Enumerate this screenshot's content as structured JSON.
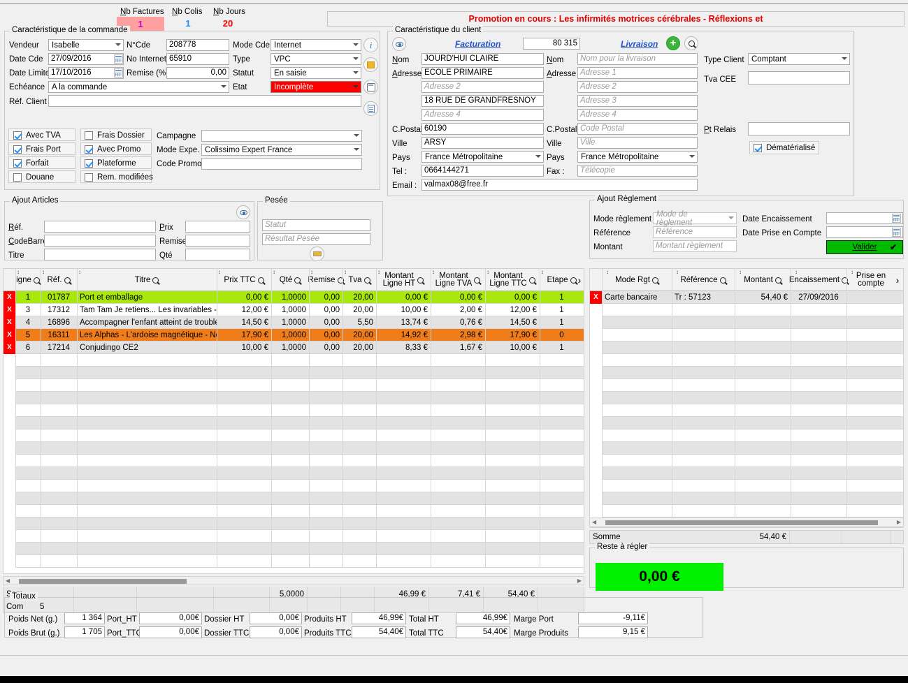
{
  "header": {
    "nb_factures_label": "Nb Factures",
    "nb_factures_value": "1",
    "nb_colis_label": "Nb Colis",
    "nb_colis_value": "1",
    "nb_jours_label": "Nb Jours",
    "nb_jours_value": "20",
    "promo_text": "Promotion en cours : Les infirmités motrices cérébrales - Réflexions et"
  },
  "order": {
    "caption": "Caractéristique de la commande",
    "vendeur_label": "Vendeur",
    "vendeur_value": "Isabelle",
    "date_cde_label": "Date Cde",
    "date_cde_value": "27/09/2016",
    "date_limite_label": "Date Limite",
    "date_limite_value": "17/10/2016",
    "echeance_label": "Echéance",
    "echeance_value": "A la commande",
    "ref_client_label": "Réf. Client",
    "ref_client_value": "",
    "ncde_label": "N°Cde",
    "ncde_value": "208778",
    "no_internet_label": "No Internet",
    "no_internet_value": "65910",
    "remise_label": "Remise (%)",
    "remise_value": "0,00",
    "mode_cde_label": "Mode Cde",
    "mode_cde_value": "Internet",
    "type_label": "Type",
    "type_value": "VPC",
    "statut_label": "Statut",
    "statut_value": "En saisie",
    "etat_label": "Etat",
    "etat_value": "Incomplète"
  },
  "checkboxes": [
    {
      "label": "Avec TVA",
      "checked": true
    },
    {
      "label": "Frais Port",
      "checked": true
    },
    {
      "label": "Forfait",
      "checked": true
    },
    {
      "label": "Douane",
      "checked": false
    },
    {
      "label": "Frais Dossier",
      "checked": false
    },
    {
      "label": "Avec Promo",
      "checked": true
    },
    {
      "label": "Plateforme",
      "checked": true
    },
    {
      "label": "Rem. modifiées",
      "checked": false
    }
  ],
  "campaign": {
    "campagne_label": "Campagne",
    "campagne_value": "",
    "mode_expe_label": "Mode Expe.",
    "mode_expe_value": "Colissimo Expert France",
    "code_promo_label": "Code Promo",
    "code_promo_value": ""
  },
  "client": {
    "caption": "Caractéristique du client",
    "facturation_link": "Facturation",
    "client_id": "80 315",
    "livraison_link": "Livraison",
    "nom_label": "Nom",
    "nom_value": "JOURD'HUI CLAIRE",
    "adresse_label": "Adresse",
    "adresse1_value": "ECOLE PRIMAIRE",
    "adresse2_ph": "Adresse 2",
    "adresse3_value": "18 RUE DE GRANDFRESNOY",
    "adresse4_ph": "Adresse 4",
    "cpostal_label": "C.Postal",
    "cpostal_value": "60190",
    "ville_label": "Ville",
    "ville_value": "ARSY",
    "pays_label": "Pays",
    "pays_value": "France Métropolitaine",
    "tel_label": "Tel :",
    "tel_value": "0664144271",
    "email_label": "Email :",
    "email_value": "valmax08@free.fr",
    "liv_nom_ph": "Nom pour la livraison",
    "liv_adresse1_ph": "Adresse 1",
    "liv_adresse2_ph": "Adresse 2",
    "liv_adresse3_ph": "Adresse 3",
    "liv_adresse4_ph": "Adresse 4",
    "liv_cp_ph": "Code Postal",
    "liv_ville_ph": "Ville",
    "liv_pays_value": "France Métropolitaine",
    "fax_label": "Fax :",
    "fax_ph": "Télécopie",
    "type_client_label": "Type Client",
    "type_client_value": "Comptant",
    "tva_cee_label": "Tva CEE",
    "tva_cee_value": "",
    "pt_relais_label": "Pt Relais",
    "pt_relais_value": "",
    "dematerialise_label": "Dématérialisé",
    "dematerialise_checked": true
  },
  "ajout_articles": {
    "caption": "Ajout Articles",
    "ref_label": "Réf.",
    "ref_value": "",
    "codebarre_label": "CodeBarre",
    "codebarre_value": "",
    "titre_label": "Titre",
    "titre_value": "",
    "prix_label": "Prix",
    "prix_value": "",
    "remise_label": "Remise",
    "remise_value": "",
    "qte_label": "Qté",
    "qte_value": ""
  },
  "pesee": {
    "caption": "Pesée",
    "statut_ph": "Statut",
    "resultat_ph": "Résultat Pesée"
  },
  "ajout_reglement": {
    "caption": "Ajout Règlement",
    "mode_label": "Mode règlement",
    "mode_ph": "Mode de règlement",
    "reference_label": "Référence",
    "reference_ph": "Référence",
    "montant_label": "Montant",
    "montant_ph": "Montant règlement",
    "date_encaissement_label": "Date Encaissement",
    "date_encaissement_value": "",
    "date_prise_label": "Date Prise en Compte",
    "date_prise_value": "",
    "valider_label": "Valider"
  },
  "articles_table": {
    "columns": [
      "igne",
      "Réf.",
      "Titre",
      "Prix TTC",
      "Qté",
      "Remise",
      "Tva",
      "Montant Ligne HT",
      "Montant Ligne TVA",
      "Montant Ligne TTC",
      "Etape"
    ],
    "rows": [
      {
        "x": "X",
        "ligne": "1",
        "ref": "01787",
        "titre": "Port et emballage",
        "prix": "0,00 €",
        "qte": "1,0000",
        "remise": "0,00",
        "tva": "20,00",
        "ht": "0,00 €",
        "tva_m": "0,00 €",
        "ttc": "0,00 €",
        "etape": "1",
        "hl": "green"
      },
      {
        "x": "X",
        "ligne": "3",
        "ref": "17312",
        "titre": "Tam Tam Je retiens... Les invariables - C",
        "prix": "12,00 €",
        "qte": "1,0000",
        "remise": "0,00",
        "tva": "20,00",
        "ht": "10,00 €",
        "tva_m": "2,00 €",
        "ttc": "12,00 €",
        "etape": "1",
        "hl": "white"
      },
      {
        "x": "X",
        "ligne": "4",
        "ref": "16896",
        "titre": "Accompagner l'enfant atteint de troubles",
        "prix": "14,50 €",
        "qte": "1,0000",
        "remise": "0,00",
        "tva": "5,50",
        "ht": "13,74 €",
        "tva_m": "0,76 €",
        "ttc": "14,50 €",
        "etape": "1",
        "hl": "alt"
      },
      {
        "x": "X",
        "ligne": "5",
        "ref": "16311",
        "titre": "Les Alphas - L'ardoise magnétique - Nouv",
        "prix": "17,90 €",
        "qte": "1,0000",
        "remise": "0,00",
        "tva": "20,00",
        "ht": "14,92 €",
        "tva_m": "2,98 €",
        "ttc": "17,90 €",
        "etape": "0",
        "hl": "orange"
      },
      {
        "x": "X",
        "ligne": "6",
        "ref": "17214",
        "titre": "Conjudingo CE2",
        "prix": "10,00 €",
        "qte": "1,0000",
        "remise": "0,00",
        "tva": "20,00",
        "ht": "8,33 €",
        "tva_m": "1,67 €",
        "ttc": "10,00 €",
        "etape": "1",
        "hl": "alt"
      }
    ],
    "footer": {
      "somme_label": "Som",
      "compte_label": "Com",
      "compte_value": "5",
      "qte_total": "5,0000",
      "ht_total": "46,99 €",
      "tva_total": "7,41 €",
      "ttc_total": "54,40 €"
    }
  },
  "payments_table": {
    "columns": [
      "Mode Rgt",
      "Référence",
      "Montant",
      "Encaissement",
      "Prise en compte"
    ],
    "rows": [
      {
        "x": "X",
        "mode": "Carte bancaire",
        "reference": "Tr : 57123",
        "montant": "54,40 €",
        "encaissement": "27/09/2016",
        "prise": ""
      }
    ],
    "somme_label": "Somme",
    "somme_value": "54,40 €"
  },
  "reste": {
    "caption": "Reste à régler",
    "value": "0,00 €"
  },
  "totaux": {
    "caption": "Totaux",
    "poids_net_label": "Poids Net (g.)",
    "poids_net_value": "1 364",
    "poids_brut_label": "Poids Brut (g.)",
    "poids_brut_value": "1 705",
    "port_ht_label": "Port_HT",
    "port_ht_value": "0,00€",
    "port_ttc_label": "Port_TTC",
    "port_ttc_value": "0,00€",
    "dossier_ht_label": "Dossier HT",
    "dossier_ht_value": "0,00€",
    "dossier_ttc_label": "Dossier TTC",
    "dossier_ttc_value": "0,00€",
    "produits_ht_label": "Produits HT",
    "produits_ht_value": "46,99€",
    "produits_ttc_label": "Produits TTC",
    "produits_ttc_value": "54,40€",
    "total_ht_label": "Total HT",
    "total_ht_value": "46,99€",
    "total_ttc_label": "Total TTC",
    "total_ttc_value": "54,40€",
    "marge_port_label": "Marge Port",
    "marge_port_value": "-9,11€",
    "marge_produits_label": "Marge Produits",
    "marge_produits_value": "9,15 €"
  }
}
